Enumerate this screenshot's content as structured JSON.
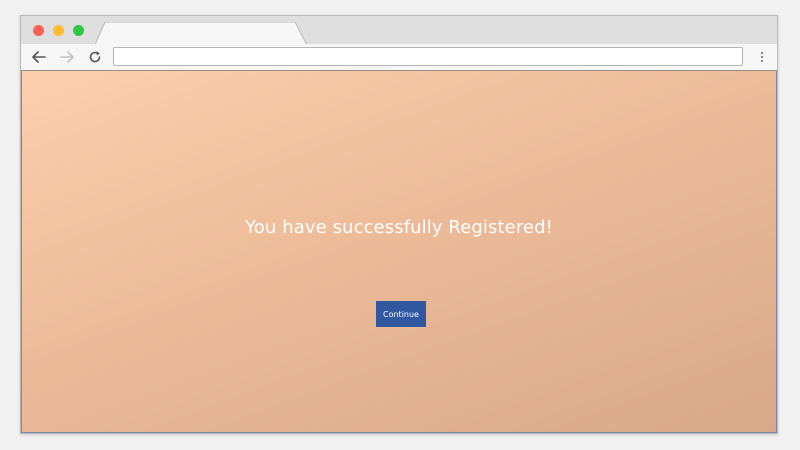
{
  "browser": {
    "colors": {
      "close": "#ff5f57",
      "minimize": "#febc2e",
      "maximize": "#28c840"
    },
    "address_bar": {
      "value": "",
      "placeholder": ""
    },
    "icons": {
      "back": "arrow-left-icon",
      "forward": "arrow-right-icon",
      "reload": "reload-icon",
      "menu": "kebab-menu-icon"
    }
  },
  "page": {
    "message": "You have successfully Registered!",
    "continue_label": "Continue",
    "colors": {
      "background_start": "#fdcfac",
      "background_end": "#d9a889",
      "button": "#2f58a0",
      "message_text": "#ffffff"
    }
  }
}
